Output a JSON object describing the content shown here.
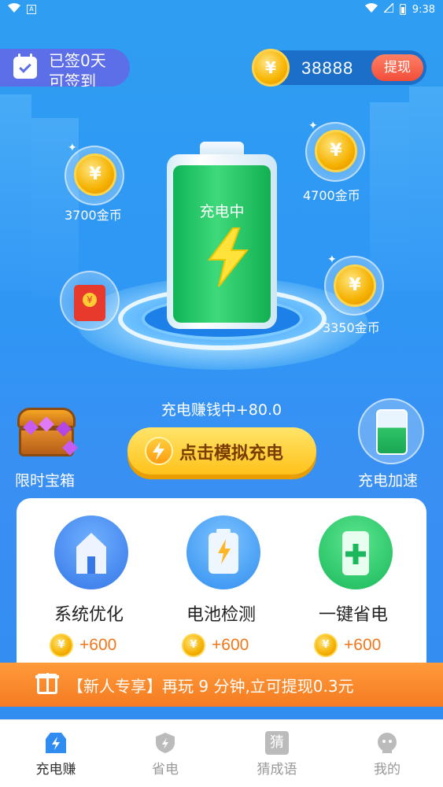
{
  "status_bar": {
    "time": "9:38"
  },
  "signin": {
    "text": "已签0天 可签到"
  },
  "balance": {
    "amount": "38888",
    "withdraw_label": "提现",
    "coin_symbol": "¥"
  },
  "battery": {
    "status_label": "充电中"
  },
  "bubbles": [
    {
      "label": "3700金币"
    },
    {
      "label": "4700金币"
    },
    {
      "label": "3350金币"
    }
  ],
  "earning_text": "充电赚钱中+80.0",
  "simulate_button": "点击模拟充电",
  "treasure": {
    "label": "限时宝箱"
  },
  "speedup": {
    "label": "充电加速"
  },
  "tools": [
    {
      "name": "系统优化",
      "reward": "+600"
    },
    {
      "name": "电池检测",
      "reward": "+600"
    },
    {
      "name": "一键省电",
      "reward": "+600"
    }
  ],
  "promo": {
    "text": "【新人专享】再玩 9 分钟,立可提现0.3元"
  },
  "nav": {
    "items": [
      {
        "label": "充电赚",
        "active": true
      },
      {
        "label": "省电"
      },
      {
        "label": "猜成语",
        "icon_text": "猜"
      },
      {
        "label": "我的"
      }
    ]
  },
  "colors": {
    "accent": "#2f9ef2",
    "promo": "#f57b21",
    "reward": "#f0761a",
    "active_nav": "#2f8cf0"
  }
}
